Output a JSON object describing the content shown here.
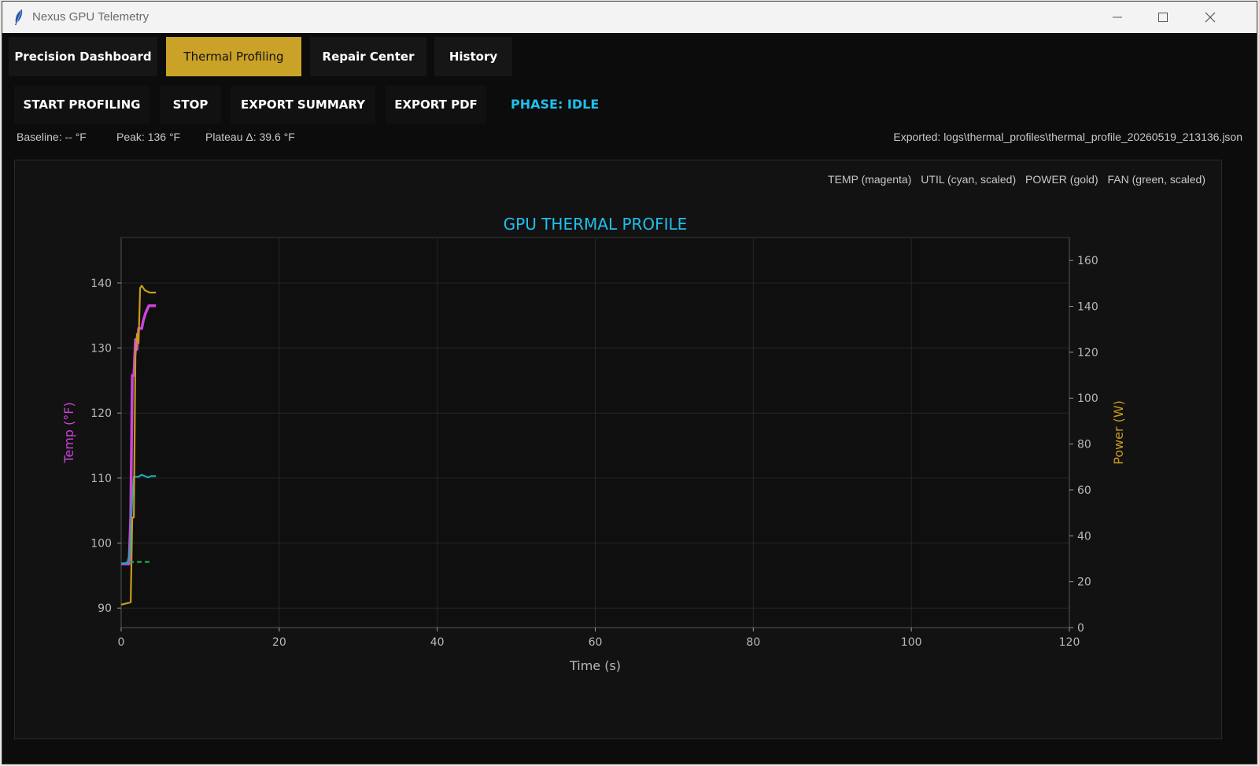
{
  "window": {
    "title": "Nexus GPU Telemetry"
  },
  "tabs": [
    {
      "label": "Precision Dashboard"
    },
    {
      "label": "Thermal Profiling"
    },
    {
      "label": "Repair Center"
    },
    {
      "label": "History"
    }
  ],
  "toolbar": {
    "start_label": "START PROFILING",
    "stop_label": "STOP",
    "export_summary_label": "EXPORT SUMMARY",
    "export_pdf_label": "EXPORT PDF",
    "phase_text": "PHASE: IDLE"
  },
  "stats": {
    "baseline": "Baseline: -- °F",
    "peak": "Peak: 136 °F",
    "plateau": "Plateau Δ: 39.6 °F",
    "exported": "Exported: logs\\thermal_profiles\\thermal_profile_20260519_213136.json"
  },
  "legend": {
    "temp": "TEMP (magenta)",
    "util": "UTIL (cyan, scaled)",
    "power": "POWER (gold)",
    "fan": "FAN (green, scaled)"
  },
  "colors": {
    "accent_gold": "#c9a227",
    "phase_cyan": "#1fc0ee",
    "temp": "#cc44dd",
    "util": "#20a8b8",
    "power": "#c99a1e",
    "fan": "#22aa55"
  },
  "chart_data": {
    "type": "line",
    "title": "GPU THERMAL PROFILE",
    "xlabel": "Time (s)",
    "ylabel_left": "Temp (°F)",
    "ylabel_right": "Power (W)",
    "xlim": [
      0,
      120
    ],
    "ylim_left": [
      87,
      147
    ],
    "ylim_right": [
      0,
      170
    ],
    "x_ticks": [
      0,
      20,
      40,
      60,
      80,
      100,
      120
    ],
    "y_ticks_left": [
      90,
      100,
      110,
      120,
      130,
      140
    ],
    "y_ticks_right": [
      0,
      20,
      40,
      60,
      80,
      100,
      120,
      140,
      160
    ],
    "grid": true,
    "series": [
      {
        "name": "TEMP",
        "axis": "left",
        "color": "#cc44dd",
        "points": [
          [
            0,
            96.8
          ],
          [
            1,
            96.8
          ],
          [
            1.2,
            104
          ],
          [
            1.4,
            125.8
          ],
          [
            1.6,
            125.8
          ],
          [
            1.8,
            131.3
          ],
          [
            2.0,
            129.8
          ],
          [
            2.2,
            133
          ],
          [
            2.6,
            133
          ],
          [
            2.8,
            134.2
          ],
          [
            3.1,
            135.4
          ],
          [
            3.5,
            136.5
          ],
          [
            4.4,
            136.5
          ]
        ]
      },
      {
        "name": "UTIL",
        "axis": "left",
        "color": "#20a8b8",
        "points": [
          [
            0,
            96.8
          ],
          [
            0.8,
            97
          ],
          [
            1.1,
            98.5
          ],
          [
            1.4,
            107
          ],
          [
            1.6,
            110.2
          ],
          [
            2.2,
            110.2
          ],
          [
            2.6,
            110.5
          ],
          [
            3.0,
            110.3
          ],
          [
            3.4,
            110.1
          ],
          [
            3.8,
            110.3
          ],
          [
            4.4,
            110.3
          ]
        ]
      },
      {
        "name": "POWER",
        "axis": "right",
        "color": "#c99a1e",
        "points": [
          [
            0,
            10
          ],
          [
            1.2,
            11
          ],
          [
            1.4,
            48
          ],
          [
            1.6,
            48
          ],
          [
            1.8,
            118
          ],
          [
            2.0,
            128
          ],
          [
            2.2,
            124
          ],
          [
            2.4,
            148
          ],
          [
            2.6,
            149
          ],
          [
            3.0,
            147
          ],
          [
            3.6,
            146
          ],
          [
            4.4,
            146
          ]
        ]
      },
      {
        "name": "FAN",
        "axis": "left",
        "color": "#22aa55",
        "dashed": true,
        "points": [
          [
            1.0,
            97.1
          ],
          [
            3.8,
            97.1
          ]
        ]
      }
    ]
  }
}
